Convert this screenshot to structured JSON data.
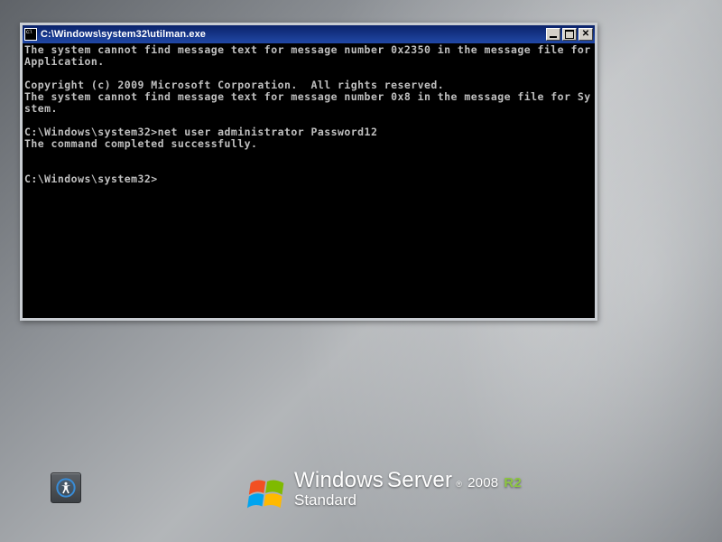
{
  "window": {
    "title": "C:\\Windows\\system32\\utilman.exe",
    "minimize_tooltip": "Minimize",
    "maximize_tooltip": "Maximize",
    "close_tooltip": "Close"
  },
  "terminal": {
    "lines": [
      "The system cannot find message text for message number 0x2350 in the message file for Application.",
      "",
      "Copyright (c) 2009 Microsoft Corporation.  All rights reserved.",
      "The system cannot find message text for message number 0x8 in the message file for System.",
      "",
      "C:\\Windows\\system32>net user administrator Password12",
      "The command completed successfully.",
      "",
      "",
      "C:\\Windows\\system32>"
    ]
  },
  "branding": {
    "product_windows": "Windows",
    "product_server": "Server",
    "year": "2008",
    "suffix": "R2",
    "edition": "Standard"
  },
  "ease_of_access": {
    "tooltip": "Ease of access"
  }
}
